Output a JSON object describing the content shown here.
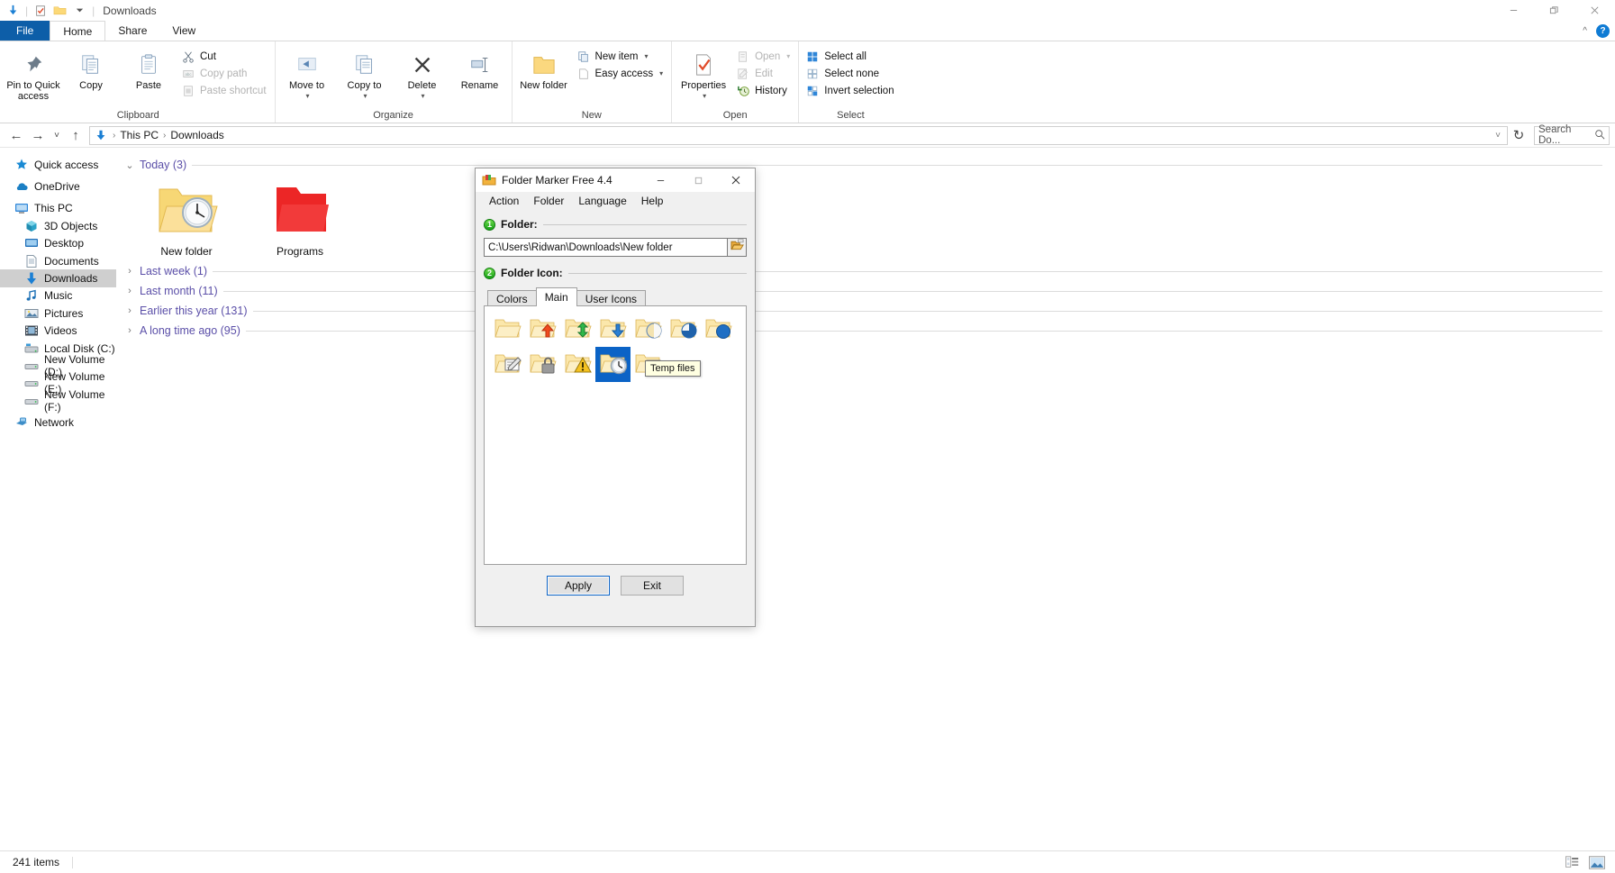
{
  "window": {
    "title": "Downloads",
    "quick_access_icons": [
      "downloads-arrow-icon",
      "properties-icon",
      "new-folder-icon",
      "chevron-down-icon"
    ],
    "minimize_label": "Minimize",
    "restore_label": "Restore",
    "close_label": "Close"
  },
  "ribbon": {
    "tabs": [
      {
        "label": "File",
        "active": false
      },
      {
        "label": "Home",
        "active": true
      },
      {
        "label": "Share",
        "active": false
      },
      {
        "label": "View",
        "active": false
      }
    ],
    "collapse_label": "^",
    "help_label": "?",
    "groups": [
      {
        "name": "Clipboard",
        "label": "Clipboard",
        "big_buttons": [
          {
            "label": "Pin to Quick access",
            "icon": "pin-icon"
          },
          {
            "label": "Copy",
            "icon": "copy-icon"
          },
          {
            "label": "Paste",
            "icon": "paste-icon"
          }
        ],
        "small_buttons": [
          {
            "label": "Cut",
            "icon": "scissors-icon",
            "dim": false
          },
          {
            "label": "Copy path",
            "icon": "copy-path-icon",
            "dim": true
          },
          {
            "label": "Paste shortcut",
            "icon": "paste-shortcut-icon",
            "dim": true
          }
        ]
      },
      {
        "name": "Organize",
        "label": "Organize",
        "big_buttons": [
          {
            "label": "Move to",
            "icon": "move-to-icon",
            "dropdown": true
          },
          {
            "label": "Copy to",
            "icon": "copy-to-icon",
            "dropdown": true
          },
          {
            "label": "Delete",
            "icon": "delete-x-icon",
            "dropdown": true
          },
          {
            "label": "Rename",
            "icon": "rename-icon"
          }
        ],
        "small_buttons": []
      },
      {
        "name": "New",
        "label": "New",
        "big_buttons": [
          {
            "label": "New folder",
            "icon": "new-folder-icon"
          }
        ],
        "small_buttons": [
          {
            "label": "New item",
            "icon": "new-item-icon",
            "dropdown": true
          },
          {
            "label": "Easy access",
            "icon": "easy-access-icon",
            "dropdown": true,
            "dim": true
          }
        ]
      },
      {
        "name": "Open",
        "label": "Open",
        "big_buttons": [
          {
            "label": "Properties",
            "icon": "properties-icon",
            "dropdown": true
          }
        ],
        "small_buttons": [
          {
            "label": "Open",
            "icon": "open-icon",
            "dropdown": true,
            "dim": true
          },
          {
            "label": "Edit",
            "icon": "edit-icon",
            "dim": true
          },
          {
            "label": "History",
            "icon": "history-icon",
            "dim": false
          }
        ]
      },
      {
        "name": "Select",
        "label": "Select",
        "big_buttons": [],
        "small_buttons": [
          {
            "label": "Select all",
            "icon": "select-all-icon"
          },
          {
            "label": "Select none",
            "icon": "select-none-icon"
          },
          {
            "label": "Invert selection",
            "icon": "invert-selection-icon"
          }
        ]
      }
    ]
  },
  "addressbar": {
    "back_label": "←",
    "forward_label": "→",
    "recent_label": "˅",
    "up_label": "↑",
    "crumbs": [
      "This PC",
      "Downloads"
    ],
    "crumb_sep": "›",
    "dropdown_label": "˅",
    "refresh_label": "↻",
    "search_placeholder": "Search Do...",
    "search_value": ""
  },
  "navpane": {
    "items": [
      {
        "label": "Quick access",
        "icon": "star-icon",
        "indent": false,
        "selected": false,
        "gap_after": true
      },
      {
        "label": "OneDrive",
        "icon": "cloud-icon",
        "indent": false,
        "selected": false,
        "gap_after": true
      },
      {
        "label": "This PC",
        "icon": "monitor-icon",
        "indent": false,
        "selected": false,
        "gap_after": false
      },
      {
        "label": "3D Objects",
        "icon": "3d-objects-icon",
        "indent": true,
        "selected": false,
        "gap_after": false
      },
      {
        "label": "Desktop",
        "icon": "desktop-icon",
        "indent": true,
        "selected": false,
        "gap_after": false
      },
      {
        "label": "Documents",
        "icon": "documents-icon",
        "indent": true,
        "selected": false,
        "gap_after": false
      },
      {
        "label": "Downloads",
        "icon": "downloads-icon",
        "indent": true,
        "selected": true,
        "gap_after": false
      },
      {
        "label": "Music",
        "icon": "music-icon",
        "indent": true,
        "selected": false,
        "gap_after": false
      },
      {
        "label": "Pictures",
        "icon": "pictures-icon",
        "indent": true,
        "selected": false,
        "gap_after": false
      },
      {
        "label": "Videos",
        "icon": "videos-icon",
        "indent": true,
        "selected": false,
        "gap_after": false
      },
      {
        "label": "Local Disk (C:)",
        "icon": "disk-icon",
        "indent": true,
        "selected": false,
        "gap_after": false
      },
      {
        "label": "New Volume (D:)",
        "icon": "drive-icon",
        "indent": true,
        "selected": false,
        "gap_after": false
      },
      {
        "label": "New Volume (E:)",
        "icon": "drive-icon",
        "indent": true,
        "selected": false,
        "gap_after": false
      },
      {
        "label": "New Volume (F:)",
        "icon": "drive-icon",
        "indent": true,
        "selected": false,
        "gap_after": true
      },
      {
        "label": "Network",
        "icon": "network-icon",
        "indent": false,
        "selected": false,
        "gap_after": false
      }
    ]
  },
  "filepane": {
    "groups": [
      {
        "title": "Today (3)",
        "expanded": true,
        "chevron": "⌄",
        "items": [
          {
            "name": "New folder",
            "icon": "folder-clock-icon",
            "color": "#f7d775"
          },
          {
            "name": "Programs",
            "icon": "folder-red-icon",
            "color": "#ec2626"
          }
        ]
      },
      {
        "title": "Last week (1)",
        "expanded": false,
        "chevron": "›",
        "items": []
      },
      {
        "title": "Last month (11)",
        "expanded": false,
        "chevron": "›",
        "items": []
      },
      {
        "title": "Earlier this year (131)",
        "expanded": false,
        "chevron": "›",
        "items": []
      },
      {
        "title": "A long time ago (95)",
        "expanded": false,
        "chevron": "›",
        "items": []
      }
    ]
  },
  "statusbar": {
    "item_count": "241 items",
    "view_buttons": [
      {
        "name": "details-view-button",
        "icon": "details-view-icon",
        "active": false
      },
      {
        "name": "large-icons-view-button",
        "icon": "large-icons-view-icon",
        "active": true
      }
    ]
  },
  "dialog": {
    "title": "Folder Marker Free 4.4",
    "app_icon": "folder-marker-icon",
    "minimize_label": "—",
    "maximize_label": "▫",
    "close_label": "✕",
    "menu": [
      "Action",
      "Folder",
      "Language",
      "Help"
    ],
    "section1": {
      "num": "1",
      "title": "Folder:"
    },
    "path_value": "C:\\Users\\Ridwan\\Downloads\\New folder",
    "browse_icon": "browse-folder-icon",
    "section2": {
      "num": "2",
      "title": "Folder Icon:"
    },
    "tabs": [
      {
        "label": "Colors",
        "active": false
      },
      {
        "label": "Main",
        "active": true
      },
      {
        "label": "User Icons",
        "active": false
      }
    ],
    "icons": [
      {
        "name": "plain-folder-icon",
        "selected": false
      },
      {
        "name": "folder-up-arrow-icon",
        "selected": false
      },
      {
        "name": "folder-updown-arrow-icon",
        "selected": false
      },
      {
        "name": "folder-down-arrow-icon",
        "selected": false
      },
      {
        "name": "folder-half-circle-icon",
        "selected": false
      },
      {
        "name": "folder-pie-icon",
        "selected": false
      },
      {
        "name": "folder-blue-dot-icon",
        "selected": false
      },
      {
        "name": "folder-document-edit-icon",
        "selected": false
      },
      {
        "name": "folder-lock-icon",
        "selected": false
      },
      {
        "name": "folder-warning-icon",
        "selected": false
      },
      {
        "name": "folder-clock-icon",
        "selected": true
      },
      {
        "name": "folder-dots-icon",
        "selected": false
      }
    ],
    "tooltip": "Temp files",
    "apply_label": "Apply",
    "exit_label": "Exit"
  }
}
